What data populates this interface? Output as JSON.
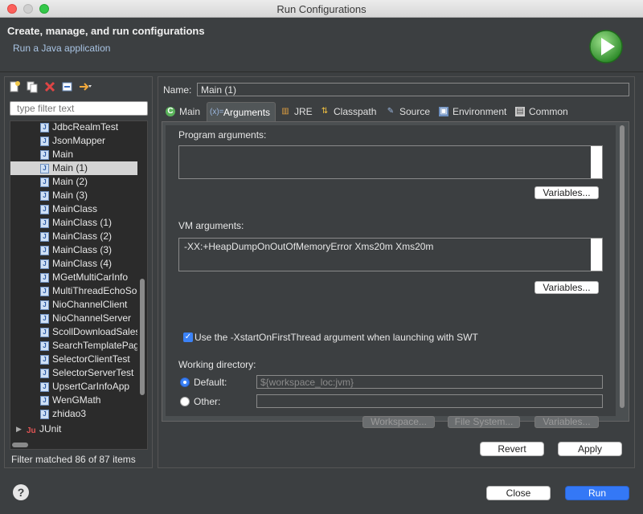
{
  "window": {
    "title": "Run Configurations"
  },
  "header": {
    "title": "Create, manage, and run configurations",
    "subtitle": "Run a Java application",
    "icon": "run-icon"
  },
  "left_panel": {
    "toolbar_icons": [
      "new-config-icon",
      "duplicate-icon",
      "delete-icon",
      "collapse-all-icon",
      "filter-dropdown-icon"
    ],
    "filter_placeholder": "type filter text",
    "items": [
      {
        "label": "JdbcRealmTest"
      },
      {
        "label": "JsonMapper"
      },
      {
        "label": "Main"
      },
      {
        "label": "Main (1)",
        "selected": true
      },
      {
        "label": "Main (2)"
      },
      {
        "label": "Main (3)"
      },
      {
        "label": "MainClass"
      },
      {
        "label": "MainClass (1)"
      },
      {
        "label": "MainClass (2)"
      },
      {
        "label": "MainClass (3)"
      },
      {
        "label": "MainClass (4)"
      },
      {
        "label": "MGetMultiCarInfo"
      },
      {
        "label": "MultiThreadEchoSoc"
      },
      {
        "label": "NioChannelClient"
      },
      {
        "label": "NioChannelServer"
      },
      {
        "label": "ScollDownloadSales"
      },
      {
        "label": "SearchTemplatePage"
      },
      {
        "label": "SelectorClientTest"
      },
      {
        "label": "SelectorServerTest"
      },
      {
        "label": "UpsertCarInfoApp"
      },
      {
        "label": "WenGMath"
      },
      {
        "label": "zhidao3"
      }
    ],
    "junit_label": "JUnit",
    "status": "Filter matched 86 of 87 items"
  },
  "right_panel": {
    "name_label": "Name:",
    "name_value": "Main (1)",
    "tabs": [
      {
        "label": "Main",
        "icon": "main-icon"
      },
      {
        "label": "Arguments",
        "icon": "arguments-icon",
        "active": true
      },
      {
        "label": "JRE",
        "icon": "jre-icon"
      },
      {
        "label": "Classpath",
        "icon": "classpath-icon"
      },
      {
        "label": "Source",
        "icon": "source-icon"
      },
      {
        "label": "Environment",
        "icon": "environment-icon"
      },
      {
        "label": "Common",
        "icon": "common-icon"
      }
    ],
    "program_args_label": "Program arguments:",
    "program_args_value": "",
    "variables_label": "Variables...",
    "vm_args_label": "VM arguments:",
    "vm_args_value": "-XX:+HeapDumpOnOutOfMemoryError Xms20m Xms20m",
    "swt_checkbox_label": "Use the -XstartOnFirstThread argument when launching with SWT",
    "working_dir_label": "Working directory:",
    "default_label": "Default:",
    "default_value": "${workspace_loc:jvm}",
    "other_label": "Other:",
    "other_value": "",
    "workspace_btn": "Workspace...",
    "filesystem_btn": "File System...",
    "revert_btn": "Revert",
    "apply_btn": "Apply"
  },
  "footer": {
    "close_btn": "Close",
    "run_btn": "Run",
    "help_icon": "help-icon"
  },
  "colors": {
    "background": "#3c3f41",
    "accent": "#3478f6",
    "selection": "#d4d4d4"
  }
}
